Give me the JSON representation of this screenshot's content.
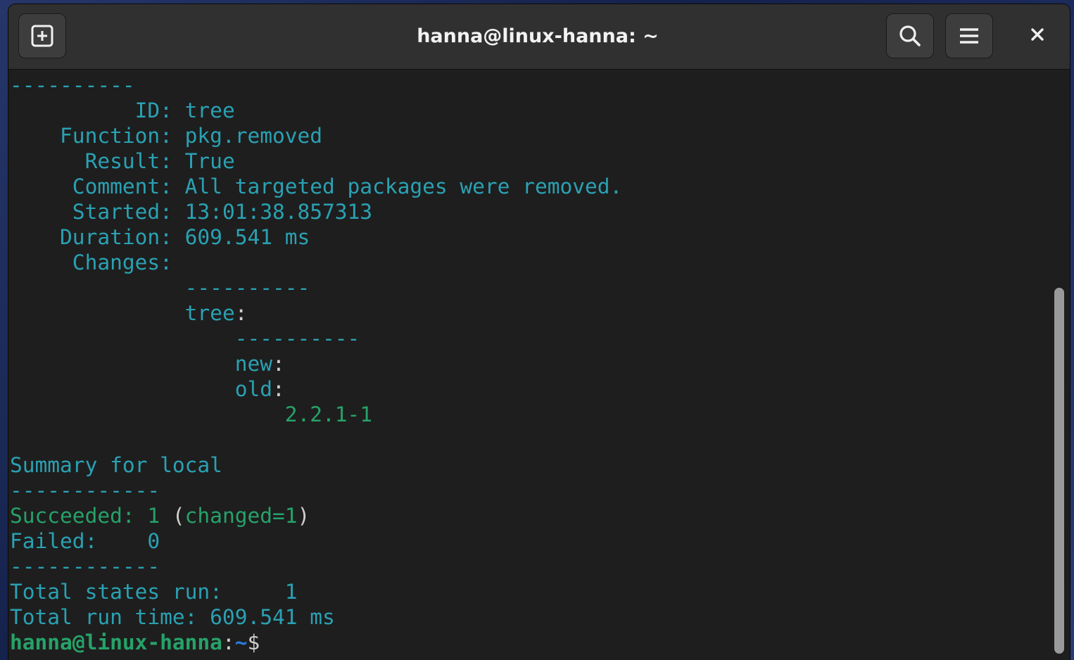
{
  "window": {
    "title": "hanna@linux-hanna: ~"
  },
  "header": {
    "new_tab_icon": "new-tab-icon",
    "search_icon": "search-icon",
    "menu_icon": "hamburger-menu-icon",
    "close_icon": "close-icon"
  },
  "colors": {
    "terminal_bg": "#1e1e1e",
    "cyan_text": "#2aa1b3",
    "green_text": "#26a269",
    "prompt_path": "#2a7bde"
  },
  "terminal": {
    "lines": {
      "l0": "----------",
      "l1_label": "          ID: ",
      "l1_value": "tree",
      "l2_label": "    Function: ",
      "l2_value": "pkg.removed",
      "l3_label": "      Result: ",
      "l3_value": "True",
      "l4_label": "     Comment: ",
      "l4_value": "All targeted packages were removed.",
      "l5_label": "     Started: ",
      "l5_value": "13:01:38.857313",
      "l6_label": "    Duration: ",
      "l6_value": "609.541 ms",
      "l7_label": "     Changes:",
      "l8": "              ----------",
      "l9_indent": "              ",
      "l9_key": "tree",
      "l9_colon": ":",
      "l10": "                  ----------",
      "l11_indent": "                  ",
      "l11_key": "new",
      "l11_colon": ":",
      "l12_indent": "                  ",
      "l12_key": "old",
      "l12_colon": ":",
      "l13": "                      2.2.1-1",
      "l15": "Summary for local",
      "l16": "------------",
      "l17_label": "Succeeded: 1 ",
      "l17_open": "(",
      "l17_changed": "changed=1",
      "l17_close": ")",
      "l18": "Failed:    0",
      "l19": "------------",
      "l20": "Total states run:     1",
      "l21": "Total run time: 609.541 ms",
      "prompt_user": "hanna@linux-hanna",
      "prompt_colon": ":",
      "prompt_path": "~",
      "prompt_symbol": "$"
    }
  }
}
